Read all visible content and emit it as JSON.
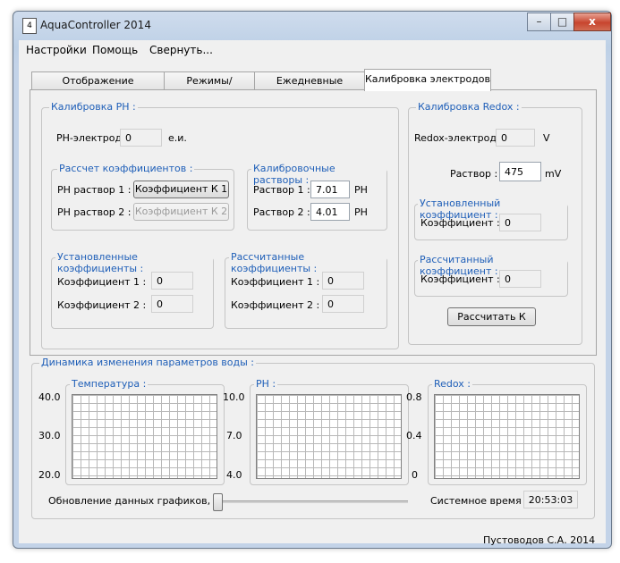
{
  "window": {
    "title": "AquaController 2014",
    "app_icon": "document-icon",
    "controls": {
      "minimize": "–",
      "maximize": "□",
      "close": "x"
    }
  },
  "menu": [
    "Настройки",
    "Помощь",
    "Свернуть..."
  ],
  "tabs": [
    "Отображение информации",
    "Режимы/События",
    "Ежедневные Таймеры",
    "Калибровка электродов"
  ],
  "active_tab": "Калибровка электродов",
  "ph": {
    "title": "Калибровка PH :",
    "electrode_label": "PH-электрод :",
    "electrode_value": "0",
    "electrode_unit": "е.и.",
    "calc_coeff": {
      "title": "Рассчет коэффициентов :",
      "row1_label": "PH раствор 1 :",
      "row1_button": "Коэффициент К 1",
      "row2_label": "PH раствор 2 :",
      "row2_button": "Коэффициент К 2"
    },
    "solutions": {
      "title": "Калибровочные растворы :",
      "row1_label": "Раствор 1 :",
      "row1_value": "7.01",
      "row1_unit": "PH",
      "row2_label": "Раствор 2 :",
      "row2_value": "4.01",
      "row2_unit": "PH"
    },
    "installed": {
      "title": "Установленные коэффициенты :",
      "k1_label": "Коэффициент 1 :",
      "k1_value": "0",
      "k2_label": "Коэффициент 2 :",
      "k2_value": "0"
    },
    "calculated": {
      "title": "Рассчитанные коэффициенты :",
      "k1_label": "Коэффициент 1 :",
      "k1_value": "0",
      "k2_label": "Коэффициент 2 :",
      "k2_value": "0"
    }
  },
  "redox": {
    "title": "Калибровка Redox :",
    "electrode_label": "Redox-электрод :",
    "electrode_value": "0",
    "electrode_unit": "V",
    "solution_label": "Раствор :",
    "solution_value": "475",
    "solution_unit": "mV",
    "installed": {
      "title": "Установленный коэффициент :",
      "label": "Коэффициент :",
      "value": "0"
    },
    "calculated": {
      "title": "Рассчитанный коэффициент :",
      "label": "Коэффициент :",
      "value": "0"
    },
    "calc_button": "Рассчитать К"
  },
  "dynamics": {
    "title": "Динамика изменения параметров воды :",
    "charts": [
      {
        "title": "Температура :",
        "y_max": "40.0",
        "y_mid": "30.0",
        "y_min": "20.0"
      },
      {
        "title": "PH :",
        "y_max": "10.0",
        "y_mid": "7.0",
        "y_min": "4.0"
      },
      {
        "title": "Redox :",
        "y_max": "0.8",
        "y_mid": "0.4",
        "y_min": "0"
      }
    ],
    "update_label": "Обновление данных графиков, с.",
    "slider_fraction": 0.0,
    "system_time_label": "Системное время :",
    "system_time_value": "20:53:03"
  },
  "footer": {
    "author": "Пустоводов С.А. 2014"
  }
}
